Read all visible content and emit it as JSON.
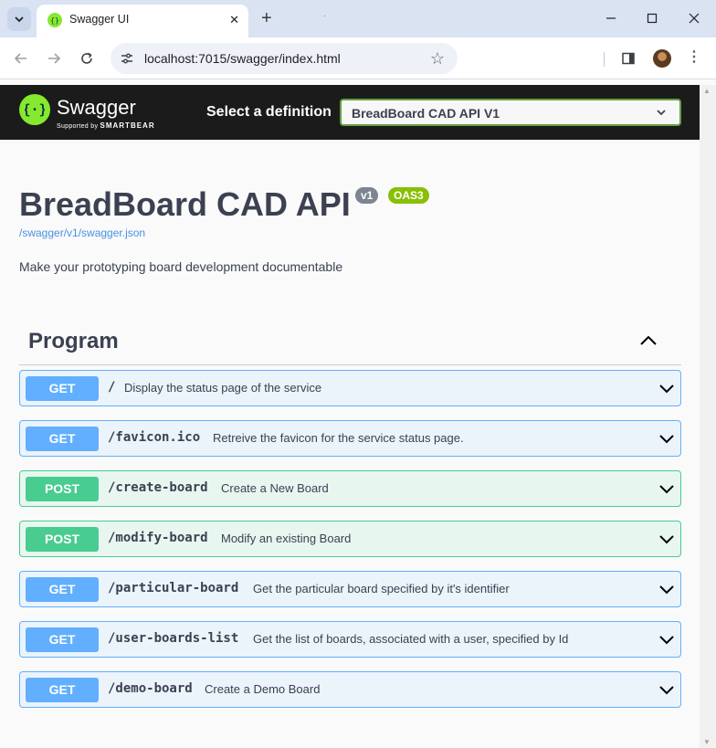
{
  "browser": {
    "tab_title": "Swagger UI",
    "tab_close": "✕",
    "new_tab": "+",
    "tab_dot": ".",
    "url": "localhost:7015/swagger/index.html"
  },
  "header": {
    "brand": "Swagger",
    "supported_by": "Supported by",
    "smartbear": "SMARTBEAR",
    "definition_label": "Select a definition",
    "definition_value": "BreadBoard CAD API V1"
  },
  "info": {
    "title": "BreadBoard CAD API",
    "version": "v1",
    "oas": "OAS3",
    "json_link": "/swagger/v1/swagger.json",
    "description": "Make your prototyping board development documentable"
  },
  "section": {
    "title": "Program"
  },
  "operations": [
    {
      "method": "GET",
      "path": "/",
      "summary": "Display the status page of the service"
    },
    {
      "method": "GET",
      "path": "/favicon.ico",
      "summary": "Retreive the favicon for the service status page."
    },
    {
      "method": "POST",
      "path": "/create-board",
      "summary": "Create a New Board"
    },
    {
      "method": "POST",
      "path": "/modify-board",
      "summary": "Modify an existing Board"
    },
    {
      "method": "GET",
      "path": "/particular-board",
      "summary": "Get the particular board specified by it's identifier"
    },
    {
      "method": "GET",
      "path": "/user-boards-list",
      "summary": "Get the list of boards, associated with a user, specified by Id"
    },
    {
      "method": "GET",
      "path": "/demo-board",
      "summary": "Create a Demo Board"
    }
  ],
  "colors": {
    "get": "#61affe",
    "post": "#49cc90",
    "swagger_green": "#85ea2d",
    "header_bg": "#1b1b1b"
  }
}
